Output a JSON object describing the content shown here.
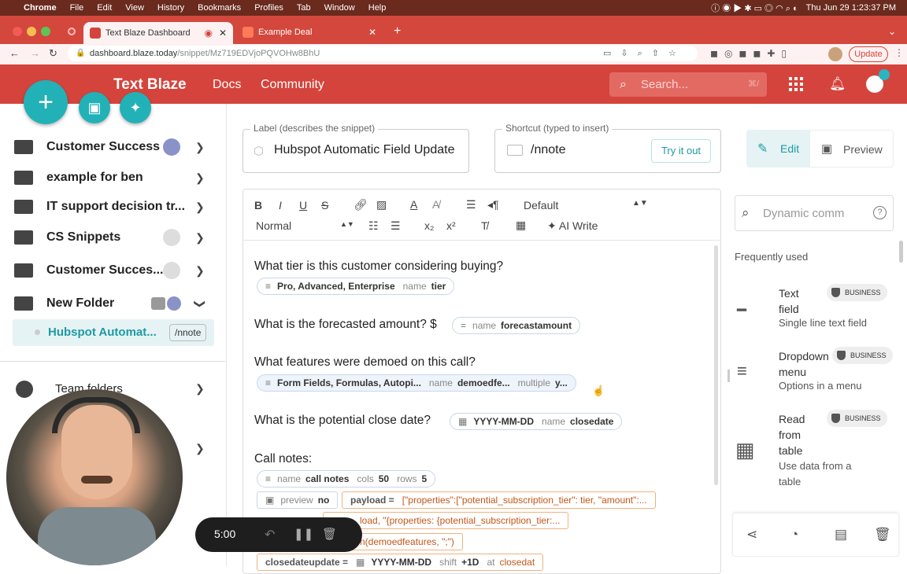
{
  "mac_menu": {
    "apple": "",
    "items": [
      "Chrome",
      "File",
      "Edit",
      "View",
      "History",
      "Bookmarks",
      "Profiles",
      "Tab",
      "Window",
      "Help"
    ],
    "clock": "Thu Jun 29  1:23:37 PM"
  },
  "browser": {
    "tabs": [
      {
        "title": "Text Blaze Dashboard",
        "active": true
      },
      {
        "title": "Example Deal",
        "active": false
      }
    ],
    "new_tab": "+",
    "url_host": "dashboard.blaze.today",
    "url_path": "/snippet/Mz719EDVjoPQVOHw8BhU",
    "update_label": "Update"
  },
  "app": {
    "brand": "Text Blaze",
    "nav": [
      "Docs",
      "Community"
    ],
    "search_placeholder": "Search...",
    "search_shortcut": "⌘/"
  },
  "sidebar": {
    "items": [
      {
        "label": "Customer Success",
        "badge": true
      },
      {
        "label": "example for ben",
        "badge": false
      },
      {
        "label": "IT support decision tr...",
        "badge": false
      },
      {
        "label": "CS Snippets",
        "badge": true
      },
      {
        "label": "Customer Succes...",
        "badge": true
      },
      {
        "label": "New Folder",
        "badge": true
      }
    ],
    "selected_snippet": {
      "label": "Hubspot Automat...",
      "shortcut": "/nnote"
    },
    "team_folders": "Team folders"
  },
  "snippet": {
    "label_caption": "Label (describes the snippet)",
    "label_value": "Hubspot Automatic Field Update",
    "shortcut_caption": "Shortcut (typed to insert)",
    "shortcut_value": "/nnote",
    "try_it_out": "Try it out",
    "edit": "Edit",
    "preview": "Preview"
  },
  "toolbar": {
    "font": "Default",
    "style": "Normal",
    "ai_write": "AI Write"
  },
  "editor": {
    "q1": "What tier is this customer considering buying?",
    "q1_chip": {
      "value": "Pro, Advanced, Enterprise",
      "name_key": "name",
      "name_val": "tier"
    },
    "q2": "What is the forecasted amount? $",
    "q2_chip": {
      "name_key": "name",
      "name_val": "forecastamount"
    },
    "q3": "What features were demoed on this call?",
    "q3_chip": {
      "value": "Form Fields, Formulas, Autopi...",
      "name_key": "name",
      "name_val": "demoedfe...",
      "multi_key": "multiple",
      "multi_val": "y..."
    },
    "q4": "What is the potential close date?",
    "q4_chip": {
      "value": "YYYY-MM-DD",
      "name_key": "name",
      "name_val": "closedate"
    },
    "q5": "Call notes:",
    "q5_chip": {
      "name_key": "name",
      "name_val": "call notes",
      "cols_key": "cols",
      "cols_val": "50",
      "rows_key": "rows",
      "rows_val": "5"
    },
    "preview_chip": {
      "key": "preview",
      "val": "no"
    },
    "payload_chip": {
      "key": "payload =",
      "val": "[\"properties\":[\"potential_subscription_tier\": tier, \"amount\":..."
    },
    "payload2_chip": {
      "val": "load, \"{properties: {potential_subscription_tier:..."
    },
    "join_chip": {
      "val": "n(demoedfeatures, \";\")"
    },
    "closedate_chip": {
      "key": "closedateupdate =",
      "val": "YYYY-MM-DD",
      "shift_key": "shift",
      "shift_val": "+1D",
      "at_key": "at",
      "at_val": "closedat"
    }
  },
  "right_panel": {
    "search_placeholder": "Dynamic comm",
    "freq_title": "Frequently used",
    "items": [
      {
        "title": "Text field",
        "subtitle": "Single line text field",
        "badge": "BUSINESS"
      },
      {
        "title": "Dropdown menu",
        "subtitle": "Options in a menu",
        "badge": "BUSINESS"
      },
      {
        "title": "Read from table",
        "subtitle": "Use data from a table",
        "badge": "BUSINESS"
      }
    ]
  },
  "recorder": {
    "time": "5:00"
  }
}
